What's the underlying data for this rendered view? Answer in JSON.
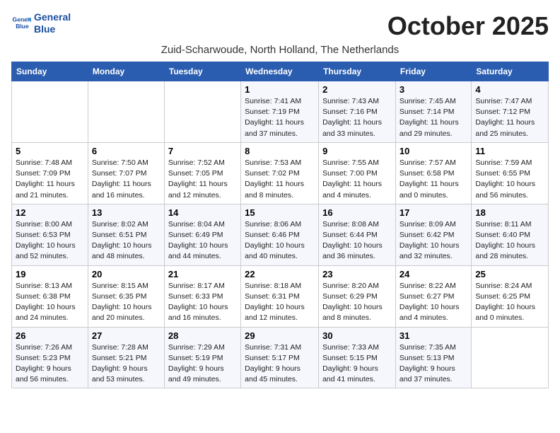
{
  "logo": {
    "line1": "General",
    "line2": "Blue"
  },
  "title": "October 2025",
  "subtitle": "Zuid-Scharwoude, North Holland, The Netherlands",
  "weekdays": [
    "Sunday",
    "Monday",
    "Tuesday",
    "Wednesday",
    "Thursday",
    "Friday",
    "Saturday"
  ],
  "weeks": [
    [
      {
        "day": "",
        "info": ""
      },
      {
        "day": "",
        "info": ""
      },
      {
        "day": "",
        "info": ""
      },
      {
        "day": "1",
        "info": "Sunrise: 7:41 AM\nSunset: 7:19 PM\nDaylight: 11 hours and 37 minutes."
      },
      {
        "day": "2",
        "info": "Sunrise: 7:43 AM\nSunset: 7:16 PM\nDaylight: 11 hours and 33 minutes."
      },
      {
        "day": "3",
        "info": "Sunrise: 7:45 AM\nSunset: 7:14 PM\nDaylight: 11 hours and 29 minutes."
      },
      {
        "day": "4",
        "info": "Sunrise: 7:47 AM\nSunset: 7:12 PM\nDaylight: 11 hours and 25 minutes."
      }
    ],
    [
      {
        "day": "5",
        "info": "Sunrise: 7:48 AM\nSunset: 7:09 PM\nDaylight: 11 hours and 21 minutes."
      },
      {
        "day": "6",
        "info": "Sunrise: 7:50 AM\nSunset: 7:07 PM\nDaylight: 11 hours and 16 minutes."
      },
      {
        "day": "7",
        "info": "Sunrise: 7:52 AM\nSunset: 7:05 PM\nDaylight: 11 hours and 12 minutes."
      },
      {
        "day": "8",
        "info": "Sunrise: 7:53 AM\nSunset: 7:02 PM\nDaylight: 11 hours and 8 minutes."
      },
      {
        "day": "9",
        "info": "Sunrise: 7:55 AM\nSunset: 7:00 PM\nDaylight: 11 hours and 4 minutes."
      },
      {
        "day": "10",
        "info": "Sunrise: 7:57 AM\nSunset: 6:58 PM\nDaylight: 11 hours and 0 minutes."
      },
      {
        "day": "11",
        "info": "Sunrise: 7:59 AM\nSunset: 6:55 PM\nDaylight: 10 hours and 56 minutes."
      }
    ],
    [
      {
        "day": "12",
        "info": "Sunrise: 8:00 AM\nSunset: 6:53 PM\nDaylight: 10 hours and 52 minutes."
      },
      {
        "day": "13",
        "info": "Sunrise: 8:02 AM\nSunset: 6:51 PM\nDaylight: 10 hours and 48 minutes."
      },
      {
        "day": "14",
        "info": "Sunrise: 8:04 AM\nSunset: 6:49 PM\nDaylight: 10 hours and 44 minutes."
      },
      {
        "day": "15",
        "info": "Sunrise: 8:06 AM\nSunset: 6:46 PM\nDaylight: 10 hours and 40 minutes."
      },
      {
        "day": "16",
        "info": "Sunrise: 8:08 AM\nSunset: 6:44 PM\nDaylight: 10 hours and 36 minutes."
      },
      {
        "day": "17",
        "info": "Sunrise: 8:09 AM\nSunset: 6:42 PM\nDaylight: 10 hours and 32 minutes."
      },
      {
        "day": "18",
        "info": "Sunrise: 8:11 AM\nSunset: 6:40 PM\nDaylight: 10 hours and 28 minutes."
      }
    ],
    [
      {
        "day": "19",
        "info": "Sunrise: 8:13 AM\nSunset: 6:38 PM\nDaylight: 10 hours and 24 minutes."
      },
      {
        "day": "20",
        "info": "Sunrise: 8:15 AM\nSunset: 6:35 PM\nDaylight: 10 hours and 20 minutes."
      },
      {
        "day": "21",
        "info": "Sunrise: 8:17 AM\nSunset: 6:33 PM\nDaylight: 10 hours and 16 minutes."
      },
      {
        "day": "22",
        "info": "Sunrise: 8:18 AM\nSunset: 6:31 PM\nDaylight: 10 hours and 12 minutes."
      },
      {
        "day": "23",
        "info": "Sunrise: 8:20 AM\nSunset: 6:29 PM\nDaylight: 10 hours and 8 minutes."
      },
      {
        "day": "24",
        "info": "Sunrise: 8:22 AM\nSunset: 6:27 PM\nDaylight: 10 hours and 4 minutes."
      },
      {
        "day": "25",
        "info": "Sunrise: 8:24 AM\nSunset: 6:25 PM\nDaylight: 10 hours and 0 minutes."
      }
    ],
    [
      {
        "day": "26",
        "info": "Sunrise: 7:26 AM\nSunset: 5:23 PM\nDaylight: 9 hours and 56 minutes."
      },
      {
        "day": "27",
        "info": "Sunrise: 7:28 AM\nSunset: 5:21 PM\nDaylight: 9 hours and 53 minutes."
      },
      {
        "day": "28",
        "info": "Sunrise: 7:29 AM\nSunset: 5:19 PM\nDaylight: 9 hours and 49 minutes."
      },
      {
        "day": "29",
        "info": "Sunrise: 7:31 AM\nSunset: 5:17 PM\nDaylight: 9 hours and 45 minutes."
      },
      {
        "day": "30",
        "info": "Sunrise: 7:33 AM\nSunset: 5:15 PM\nDaylight: 9 hours and 41 minutes."
      },
      {
        "day": "31",
        "info": "Sunrise: 7:35 AM\nSunset: 5:13 PM\nDaylight: 9 hours and 37 minutes."
      },
      {
        "day": "",
        "info": ""
      }
    ]
  ]
}
